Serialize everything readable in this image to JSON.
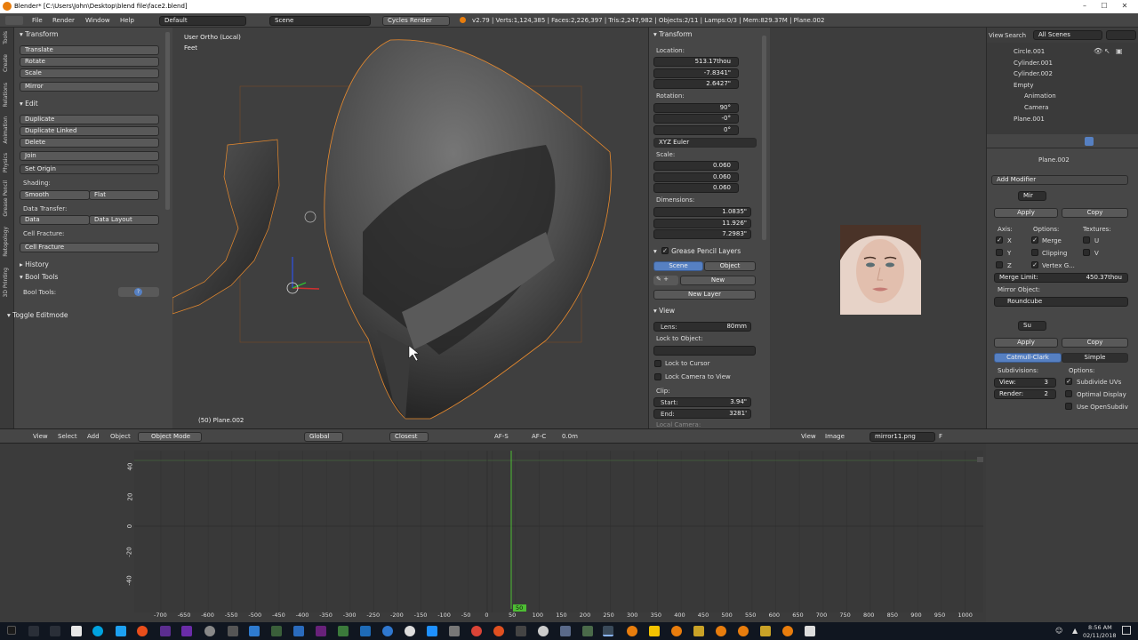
{
  "window": {
    "title": "Blender* [C:\\Users\\John\\Desktop\\blend file\\face2.blend]",
    "min": "–",
    "max": "☐",
    "close": "✕"
  },
  "menubar": {
    "items": [
      "File",
      "Render",
      "Window",
      "Help"
    ],
    "layout": "Default",
    "scene": "Scene",
    "engine": "Cycles Render",
    "stats": "v2.79 | Verts:1,124,385 | Faces:2,226,397 | Tris:2,247,982 | Objects:2/11 | Lamps:0/3 | Mem:829.37M | Plane.002"
  },
  "toolshelf": {
    "tabs": [
      "Tools",
      "Create",
      "Relations",
      "Animation",
      "Physics",
      "Grease Pencil",
      "Retopology",
      "3D Printing"
    ],
    "transform_header": "Transform",
    "transform_buttons": [
      "Translate",
      "Rotate",
      "Scale",
      "Mirror"
    ],
    "edit_header": "Edit",
    "edit_buttons": [
      "Duplicate",
      "Duplicate Linked",
      "Delete",
      "Join"
    ],
    "set_origin": "Set Origin",
    "shading_label": "Shading:",
    "smooth": "Smooth",
    "flat": "Flat",
    "data_transfer_label": "Data Transfer:",
    "data": "Data",
    "data_layout": "Data Layout",
    "cell_fracture_label": "Cell Fracture:",
    "cell_fracture": "Cell Fracture",
    "history_header": "History",
    "booltools_header": "Bool Tools",
    "booltools_label": "Bool Tools:",
    "toggle_editmode": "Toggle Editmode"
  },
  "viewport": {
    "view_label": "User Ortho (Local)",
    "units": "Feet",
    "object_label": "(50) Plane.002"
  },
  "npanel": {
    "transform_header": "Transform",
    "location_label": "Location:",
    "loc_x": "513.17thou",
    "loc_y": "-7.8341\"",
    "loc_z": "2.6427\"",
    "rotation_label": "Rotation:",
    "rot_x": "90°",
    "rot_y": "-0°",
    "rot_z": "0°",
    "rot_mode": "XYZ Euler",
    "scale_label": "Scale:",
    "scale_x": "0.060",
    "scale_y": "0.060",
    "scale_z": "0.060",
    "dimensions_label": "Dimensions:",
    "dim_x": "1.0835\"",
    "dim_y": "11.926\"",
    "dim_z": "7.2983\"",
    "gp_header": "Grease Pencil Layers",
    "gp_scene": "Scene",
    "gp_object": "Object",
    "gp_new": "New",
    "gp_new_layer": "New Layer",
    "view_header": "View",
    "lens_label": "Lens:",
    "lens": "80mm",
    "lock_object_label": "Lock to Object:",
    "lock_cursor": "Lock to Cursor",
    "lock_camera": "Lock Camera to View",
    "clip_label": "Clip:",
    "clip_start_label": "Start:",
    "clip_start": "3.94\"",
    "clip_end_label": "End:",
    "clip_end": "3281'",
    "local_camera": "Local Camera:"
  },
  "outliner": {
    "view": "View",
    "search": "Search",
    "scenes": "All Scenes",
    "items": [
      "Circle.001",
      "Cylinder.001",
      "Cylinder.002",
      "Empty",
      "Animation",
      "Camera",
      "Plane.001"
    ]
  },
  "props": {
    "object": "Plane.002",
    "add_modifier": "Add Modifier",
    "mirror": {
      "name": "Mir",
      "apply": "Apply",
      "copy": "Copy",
      "axis_label": "Axis:",
      "options_label": "Options:",
      "textures_label": "Textures:",
      "x": "X",
      "y": "Y",
      "z": "Z",
      "merge": "Merge",
      "clipping": "Clipping",
      "vertex_groups": "Vertex G...",
      "u": "U",
      "v": "V",
      "merge_limit_label": "Merge Limit:",
      "merge_limit": "450.37thou",
      "mirror_object_label": "Mirror Object:",
      "mirror_object": "Roundcube"
    },
    "subsurf": {
      "name": "Su",
      "apply": "Apply",
      "copy": "Copy",
      "catmull": "Catmull-Clark",
      "simple": "Simple",
      "subdivisions_label": "Subdivisions:",
      "options_label": "Options:",
      "view_label": "View:",
      "view": "3",
      "render_label": "Render:",
      "render": "2",
      "subdivide_uvs": "Subdivide UVs",
      "optimal_display": "Optimal Display",
      "use_opensubdiv": "Use OpenSubdiv"
    }
  },
  "header3d": {
    "view": "View",
    "select": "Select",
    "add": "Add",
    "object": "Object",
    "mode": "Object Mode",
    "orientation": "Global",
    "snap": "Closest",
    "afs": "AF-S",
    "afc": "AF-C",
    "value": "0.0m"
  },
  "imageheader": {
    "view": "View",
    "image": "Image",
    "file": "mirror11.png",
    "f": "F"
  },
  "timeline": {
    "y_ticks": [
      "40",
      "20",
      "0",
      "-20",
      "-40"
    ],
    "x_ticks": [
      "-700",
      "-650",
      "-600",
      "-550",
      "-500",
      "-450",
      "-400",
      "-350",
      "-300",
      "-250",
      "-200",
      "-150",
      "-100",
      "-50",
      "0",
      "50",
      "100",
      "150",
      "200",
      "250",
      "300",
      "350",
      "400",
      "450",
      "500",
      "550",
      "600",
      "650",
      "700",
      "750",
      "800",
      "850",
      "900",
      "950",
      "1000"
    ],
    "current_frame": "50"
  },
  "taskbar": {
    "time": "8:56 AM",
    "date": "02/11/2018"
  },
  "colors": {
    "accent": "#5680c2",
    "selection": "#e88a2d",
    "frame_line": "#4dbd33"
  }
}
